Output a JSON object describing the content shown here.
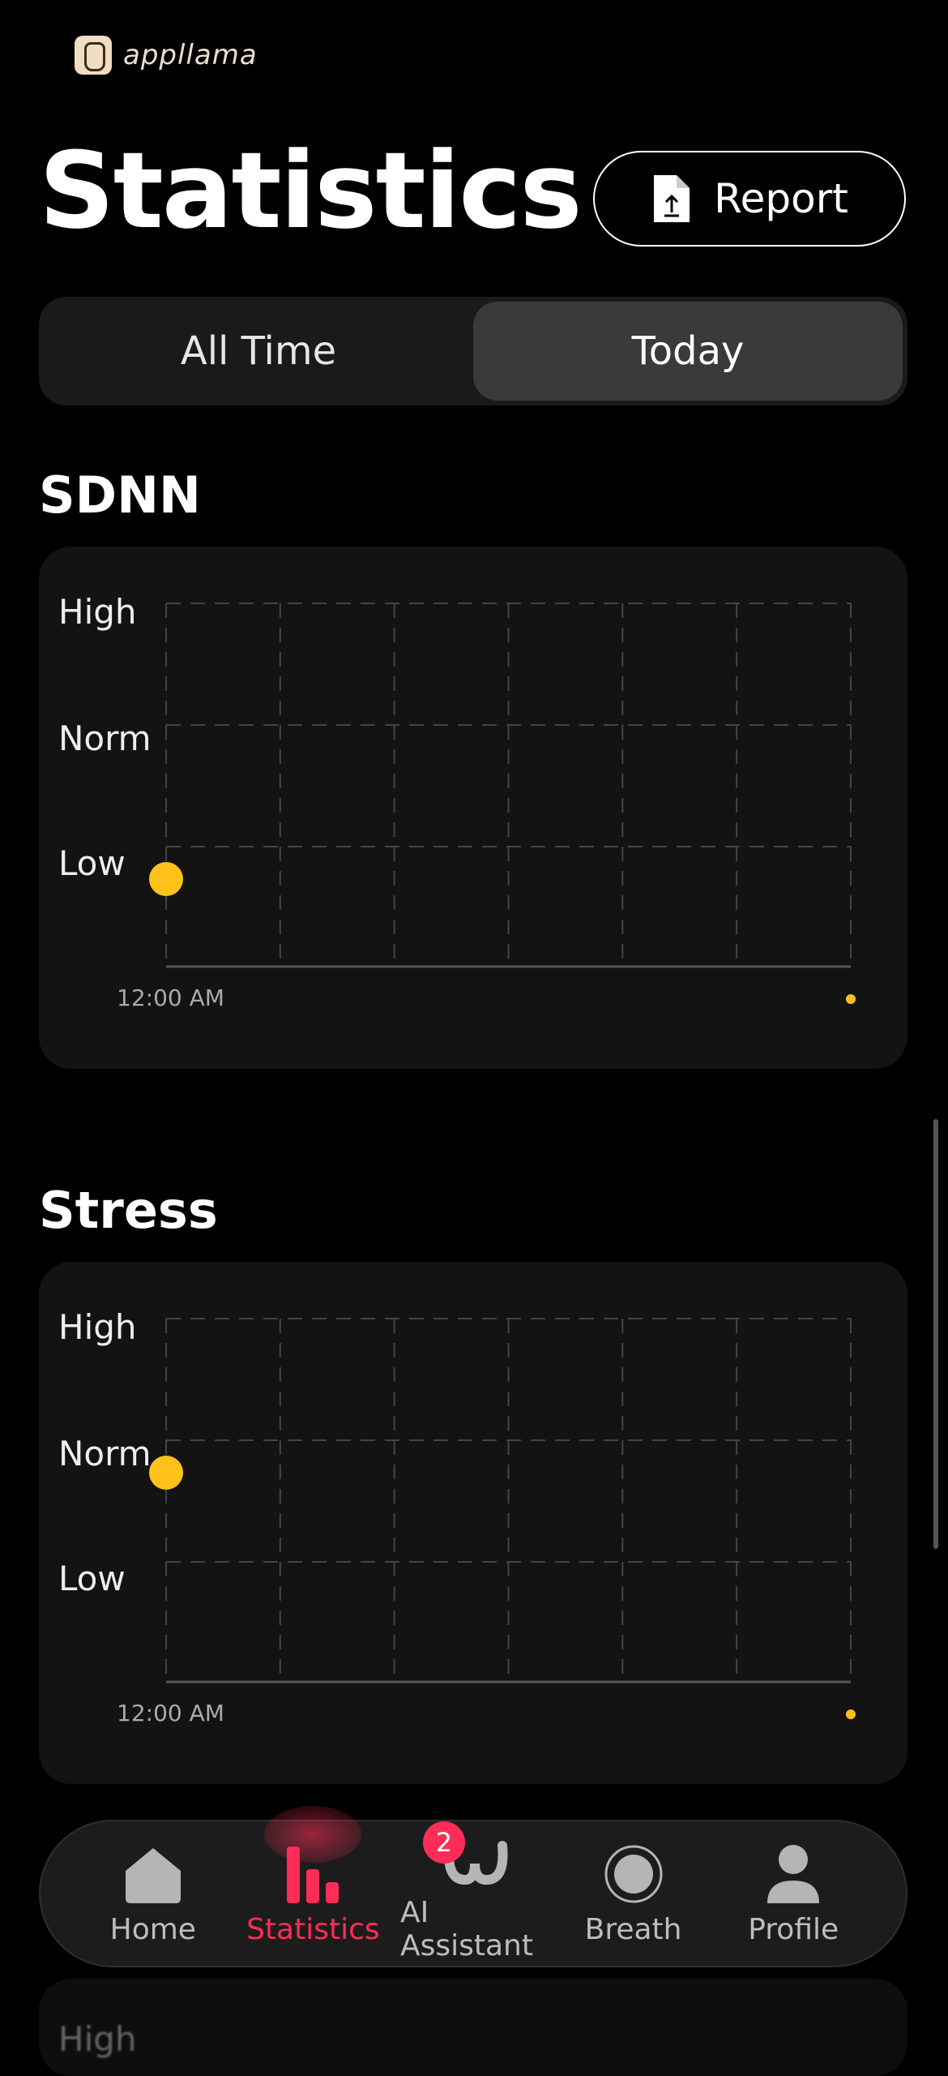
{
  "brand": {
    "name": "appllama"
  },
  "header": {
    "title": "Statistics",
    "report_label": "Report"
  },
  "segment": {
    "options": [
      "All Time",
      "Today"
    ],
    "selected": "Today"
  },
  "charts": [
    {
      "section": "SDNN",
      "y_labels": [
        "High",
        "Norm",
        "Low"
      ],
      "x_label": "12:00 AM",
      "point_level": "Low"
    },
    {
      "section": "Stress",
      "y_labels": [
        "High",
        "Norm",
        "Low"
      ],
      "x_label": "12:00 AM",
      "point_level": "Norm"
    }
  ],
  "colors": {
    "accent": "#ff2d55",
    "point": "#ffc21a",
    "grid": "#444444"
  },
  "nav": {
    "items": [
      {
        "label": "Home",
        "icon": "home-icon"
      },
      {
        "label": "Statistics",
        "icon": "bar-chart-icon",
        "active": true
      },
      {
        "label": "AI Assistant",
        "icon": "ai-assistant-icon",
        "badge": "2"
      },
      {
        "label": "Breath",
        "icon": "breath-icon"
      },
      {
        "label": "Profile",
        "icon": "profile-icon"
      }
    ]
  },
  "peek": {
    "label": "High"
  }
}
